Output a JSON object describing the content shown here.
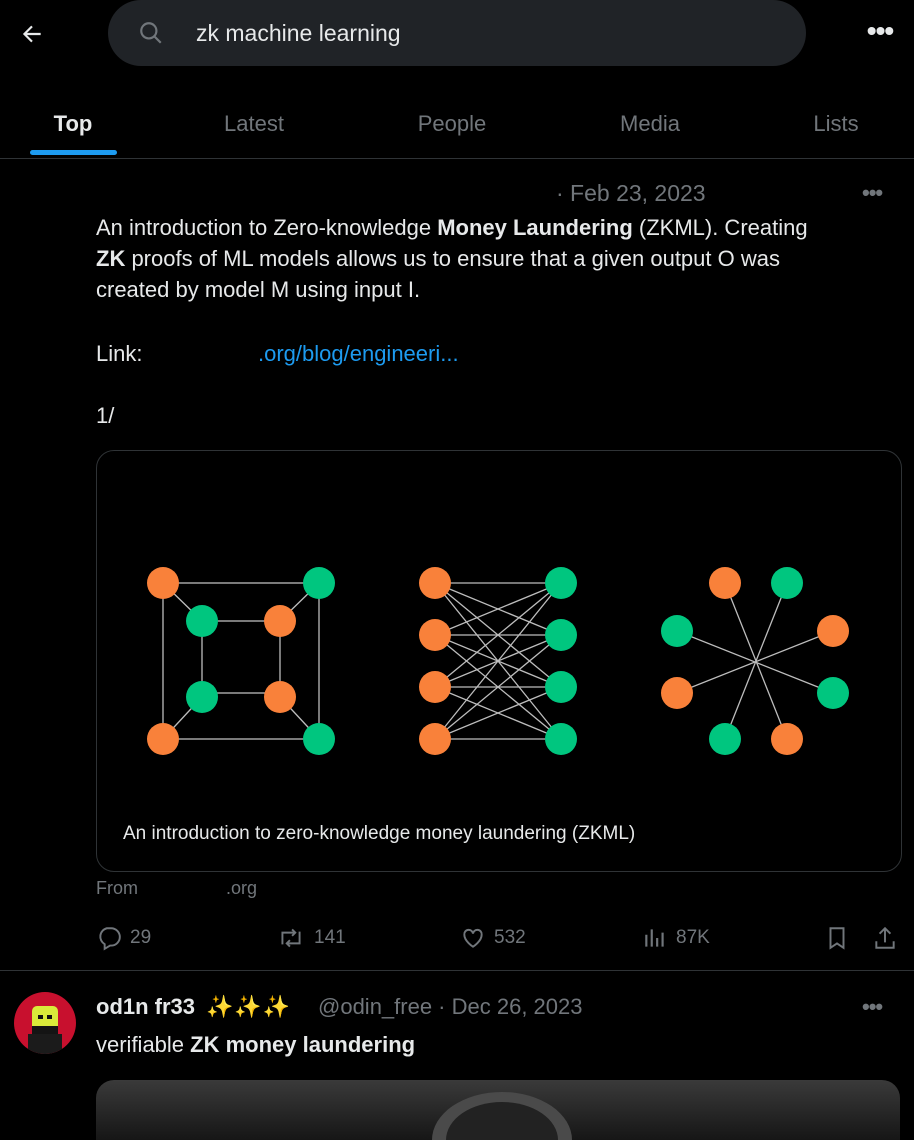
{
  "search": {
    "query": "zk machine learning"
  },
  "tabs": [
    {
      "label": "Top",
      "active": true
    },
    {
      "label": "Latest",
      "active": false
    },
    {
      "label": "People",
      "active": false
    },
    {
      "label": "Media",
      "active": false
    },
    {
      "label": "Lists",
      "active": false
    }
  ],
  "tweet1": {
    "date": "· Feb 23, 2023",
    "text": {
      "p1_a": "An introduction to Zero-knowledge ",
      "p1_b": "Money Laundering",
      "p1_c": " (ZKML). Creating",
      "p2_a": "ZK",
      "p2_b": " proofs of ML models allows us to ensure that a given output O was",
      "p3": "created by model M using input I.",
      "link_label": "Link:",
      "link_text": ".org/blog/engineeri...",
      "thread_marker": "1/"
    },
    "card_caption": "An introduction to zero-knowledge money laundering (ZKML)",
    "from_label": "From",
    "from_domain": ".org",
    "stats": {
      "replies": "29",
      "reposts": "141",
      "likes": "532",
      "views": "87K"
    }
  },
  "tweet2": {
    "name": "od1n fr33",
    "emoji": "✨✨✨",
    "handle_date": "@odin_free · Dec 26, 2023",
    "text_a": "verifiable ",
    "text_b": "ZK money laundering"
  },
  "colors": {
    "accent": "#1d9bf0",
    "orange": "#f9813a",
    "green": "#00c67f",
    "background": "#000000"
  }
}
